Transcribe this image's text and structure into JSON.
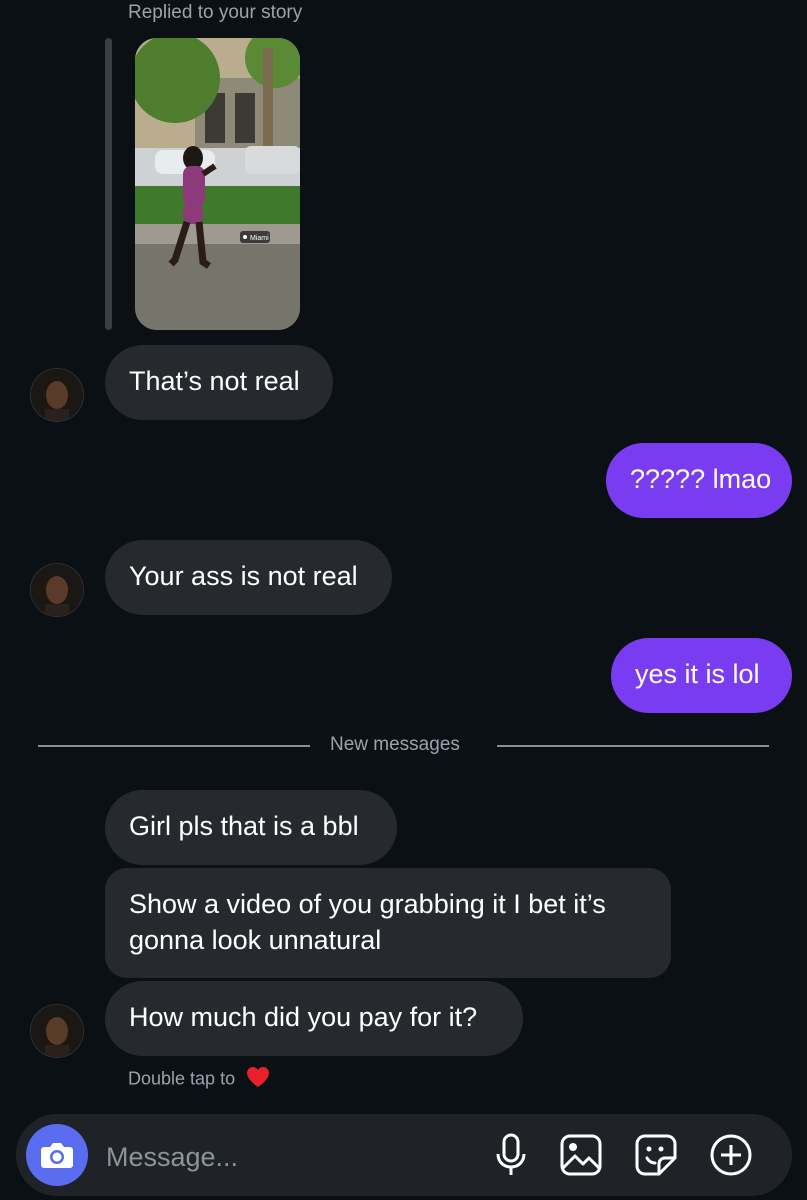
{
  "story": {
    "label": "Replied to your story",
    "location_tag": "Miami"
  },
  "messages": [
    {
      "id": "m1",
      "side": "received",
      "text": "That’s not real"
    },
    {
      "id": "m2",
      "side": "sent",
      "text": "????? lmao"
    },
    {
      "id": "m3",
      "side": "received",
      "text": "Your ass is not real"
    },
    {
      "id": "m4",
      "side": "sent",
      "text": "yes it is lol"
    },
    {
      "id": "m5",
      "side": "received",
      "text": "Girl pls that is a bbl"
    },
    {
      "id": "m6",
      "side": "received",
      "text": "Show a video of you grabbing it I bet it’s gonna look unnatural"
    },
    {
      "id": "m7",
      "side": "received",
      "text": "How much did you pay for it?"
    }
  ],
  "divider": {
    "label": "New messages"
  },
  "hint": {
    "text": "Double tap to",
    "icon": "heart-icon"
  },
  "composer": {
    "placeholder": "Message...",
    "icons": [
      "camera-icon",
      "microphone-icon",
      "gallery-icon",
      "sticker-icon",
      "add-icon"
    ]
  },
  "colors": {
    "background": "#0b1014",
    "received_bubble": "#262a2e",
    "sent_bubble": "#7a3cf0",
    "camera_button": "#5a6cf0",
    "heart": "#e8202a"
  }
}
